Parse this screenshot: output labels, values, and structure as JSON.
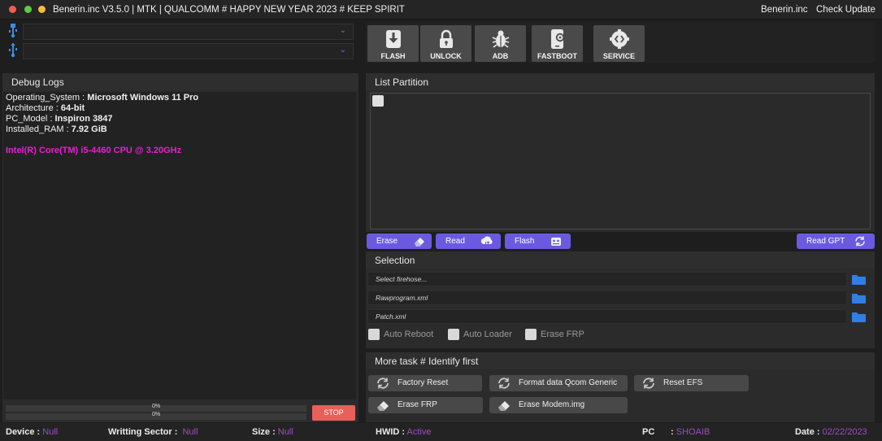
{
  "window": {
    "title": "Benerin.inc V3.5.0 | MTK | QUALCOMM # HAPPY NEW YEAR 2023 # KEEP SPIRIT",
    "brand": "Benerin.inc",
    "check_update": "Check Update",
    "controls": [
      "close",
      "minimize",
      "maximize"
    ],
    "control_colors": [
      "#ee5c54",
      "#f5be3a",
      "#5fcb44"
    ]
  },
  "ports": [
    {
      "icon": "usb-icon",
      "value": ""
    },
    {
      "icon": "usb-icon",
      "value": ""
    }
  ],
  "toolbar": [
    {
      "label": "FLASH",
      "icon": "download-icon"
    },
    {
      "label": "UNLOCK",
      "icon": "lock-icon"
    },
    {
      "label": "ADB",
      "icon": "bug-icon"
    },
    {
      "label": "FASTBOOT",
      "icon": "phone-gear-icon"
    },
    {
      "label": "SERVICE",
      "icon": "code-gear-icon"
    }
  ],
  "debug": {
    "title": "Debug Logs",
    "lines": [
      {
        "key": "Operating_System",
        "value": "Microsoft Windows 11 Pro"
      },
      {
        "key": "Architecture",
        "value": "64-bit"
      },
      {
        "key": "PC_Model",
        "value": "Inspiron 3847"
      },
      {
        "key": "Installed_RAM",
        "value": "7.92 GiB"
      }
    ],
    "cpu": "Intel(R) Core(TM) i5-4460  CPU @ 3.20GHz",
    "cpu_color": "#e81fd6",
    "progress": [
      {
        "label": "0%",
        "value": 0
      },
      {
        "label": "0%",
        "value": 0
      }
    ],
    "stop_label": "STOP"
  },
  "partition": {
    "title": "List Partition",
    "buttons": [
      {
        "label": "Erase",
        "icon": "eraser-icon"
      },
      {
        "label": "Read",
        "icon": "cloud-download-icon"
      },
      {
        "label": "Flash",
        "icon": "chip-icon"
      }
    ],
    "read_gpt": {
      "label": "Read GPT",
      "icon": "refresh-icon"
    }
  },
  "selection": {
    "title": "Selection",
    "fields": [
      {
        "placeholder": "Select firehose..."
      },
      {
        "placeholder": "Rawprogram.xml"
      },
      {
        "placeholder": "Patch.xml"
      }
    ],
    "options": [
      "Auto Reboot",
      "Auto Loader",
      "Erase FRP"
    ]
  },
  "more_task": {
    "title": "More task # Identify first",
    "row1": [
      {
        "label": "Factory Reset",
        "icon": "refresh-icon"
      },
      {
        "label": "Format data Qcom Generic",
        "icon": "refresh-icon"
      },
      {
        "label": "Reset EFS",
        "icon": "refresh-icon"
      }
    ],
    "row2": [
      {
        "label": "Erase FRP",
        "icon": "eraser-icon"
      },
      {
        "label": "Erase Modem.img",
        "icon": "eraser-icon"
      }
    ]
  },
  "status": {
    "device": {
      "label": "Device :",
      "value": "Null"
    },
    "writing_sector": {
      "label": "Writting Sector :",
      "value": "Null"
    },
    "size": {
      "label": "Size :",
      "value": "Null"
    },
    "hwid": {
      "label": "HWID :",
      "value": "Active"
    },
    "pc": {
      "label": "PC",
      "sep": ":",
      "value": "SHOAIB"
    },
    "date": {
      "label": "Date :",
      "value": "02/22/2023"
    },
    "accent": "#9b4fbf"
  },
  "colors": {
    "accent": "#6b5ae0",
    "folder": "#2f7fe6",
    "stop": "#e8605a"
  }
}
